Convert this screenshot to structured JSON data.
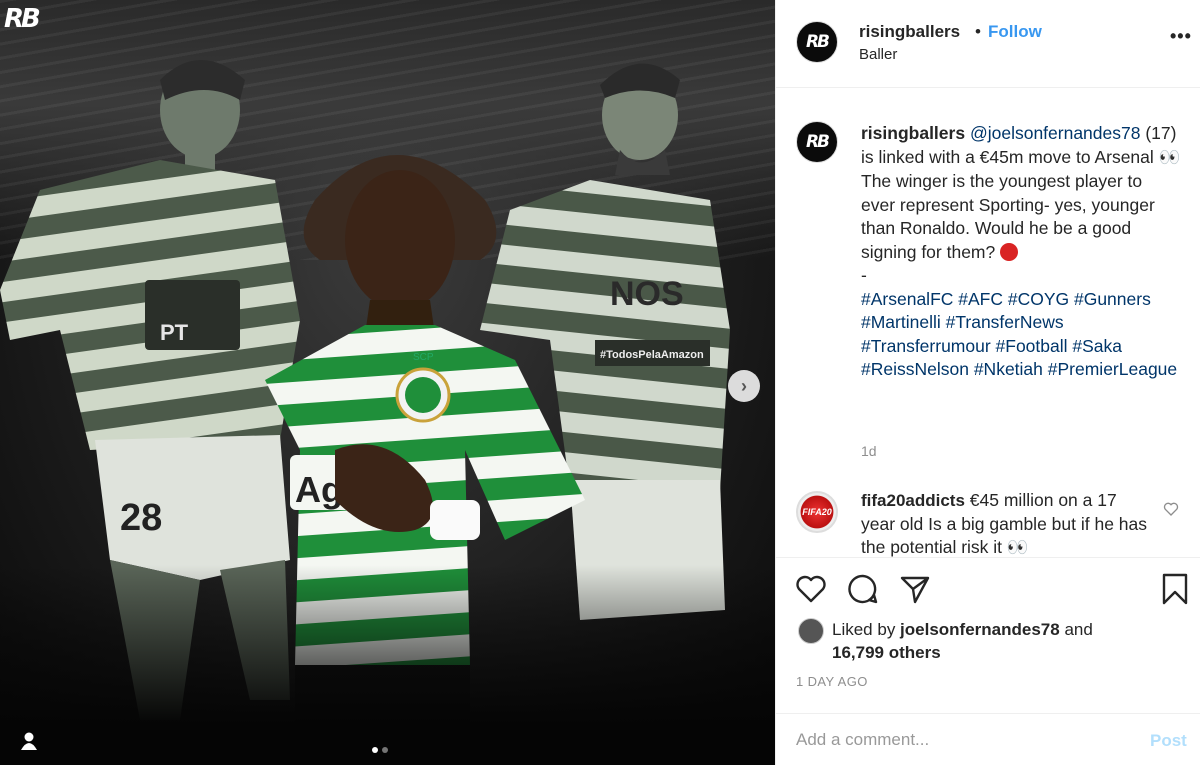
{
  "media": {
    "logo_text": "RB",
    "players": [
      {
        "number": "28",
        "sponsor": "PT"
      },
      {
        "sponsor": "Agril",
        "badge": "SCP"
      },
      {
        "sponsor": "NOS",
        "banner": "#TodosPelaAmazon"
      }
    ],
    "carousel": {
      "current": 1,
      "total": 2
    }
  },
  "header": {
    "avatar_text": "RB",
    "username": "risingballers",
    "separator": "•",
    "follow_label": "Follow",
    "subtitle": "Baller",
    "more_label": "•••"
  },
  "caption": {
    "avatar_text": "RB",
    "username": "risingballers",
    "mention": "@joelsonfernandes78",
    "text_1": " (17) is linked with a €45m move to Arsenal ",
    "emoji_eyes": "👀",
    "text_2": " The winger is the youngest player to ever represent Sporting- yes, younger than Ronaldo. Would he be a good signing for them? ",
    "dash": "-",
    "hashtags": "#ArsenalFC #AFC #COYG #Gunners #Martinelli #TransferNews #Transferrumour #Football #Saka #ReissNelson #Nketiah #PremierLeague",
    "time": "1d"
  },
  "comment": {
    "avatar_text": "FIFA20",
    "username": "fifa20addicts",
    "text": " €45 million on a 17 year old Is a big gamble but if he has the potential risk it ",
    "emoji": "👀"
  },
  "actions": {
    "icons": [
      "heart-icon",
      "comment-icon",
      "share-icon",
      "bookmark-icon"
    ]
  },
  "likes": {
    "prefix": "Liked by ",
    "user": "joelsonfernandes78",
    "middle": " and",
    "count": "16,799 others",
    "time": "1 DAY AGO"
  },
  "add_comment": {
    "placeholder": "Add a comment...",
    "post_label": "Post"
  }
}
